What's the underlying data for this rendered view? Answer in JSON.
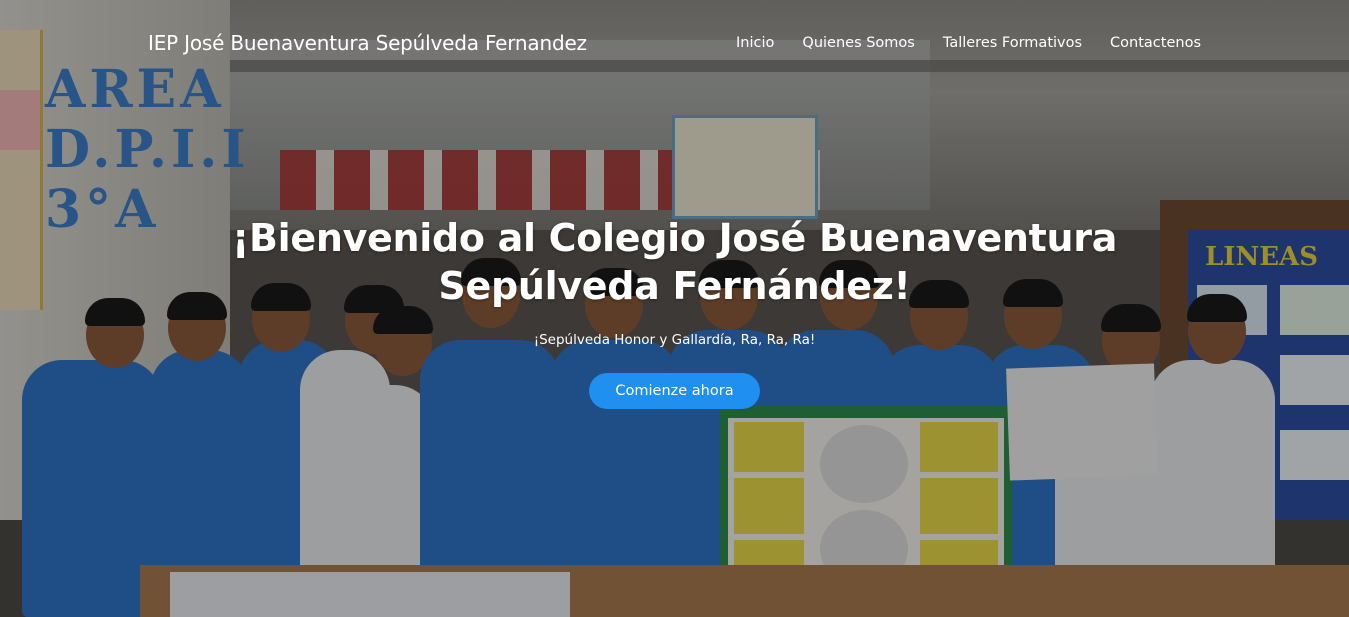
{
  "nav": {
    "brand": "IEP José Buenaventura Sepúlveda Fernandez",
    "links": [
      {
        "label": "Inicio"
      },
      {
        "label": "Quienes Somos"
      },
      {
        "label": "Talleres Formativos"
      },
      {
        "label": "Contactenos"
      }
    ]
  },
  "hero": {
    "title": "¡Bienvenido al Colegio José Buenaventura Sepúlveda Fernández!",
    "subtitle": "¡Sepúlveda Honor y Gallardía, Ra, Ra, Ra!",
    "cta_label": "Comienze ahora"
  },
  "background_photo": {
    "wall_text": "AREA D.P.I.I 3°A",
    "board_text": "LINEAS"
  },
  "colors": {
    "accent": "#1f8ff0",
    "text": "#ffffff"
  }
}
